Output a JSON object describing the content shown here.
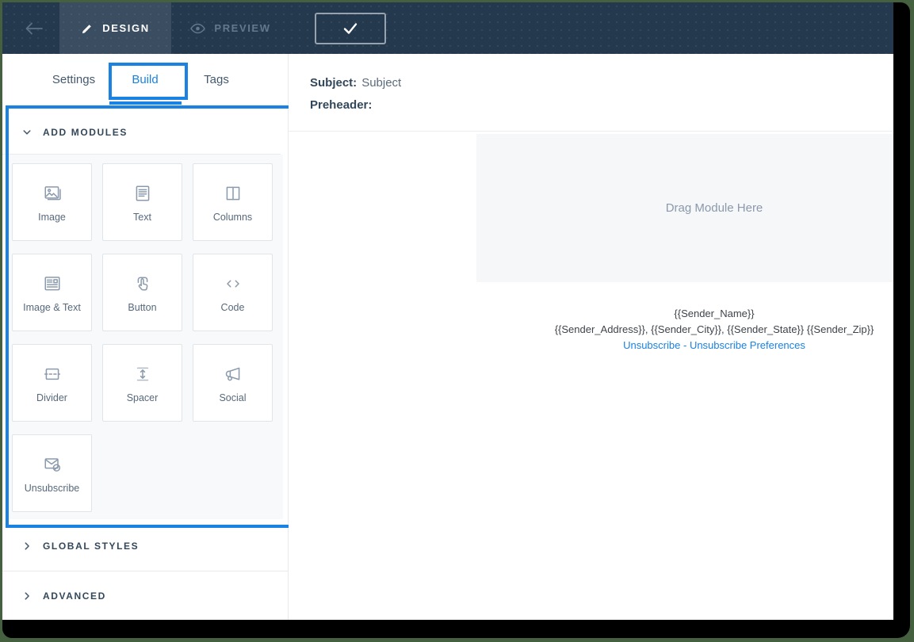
{
  "topbar": {
    "back_icon": "arrow-left-icon",
    "tabs": [
      {
        "label": "DESIGN",
        "icon": "pencil-icon",
        "active": true
      },
      {
        "label": "PREVIEW",
        "icon": "eye-icon",
        "active": false
      }
    ],
    "confirm_icon": "check-icon"
  },
  "sidebar": {
    "tabs": [
      {
        "label": "Settings",
        "active": false
      },
      {
        "label": "Build",
        "active": true
      },
      {
        "label": "Tags",
        "active": false
      }
    ],
    "sections": [
      {
        "label": "ADD MODULES",
        "expanded": true,
        "icon": "chevron-down-icon"
      },
      {
        "label": "GLOBAL STYLES",
        "expanded": false,
        "icon": "chevron-right-icon"
      },
      {
        "label": "ADVANCED",
        "expanded": false,
        "icon": "chevron-right-icon"
      }
    ],
    "modules": [
      {
        "label": "Image",
        "icon": "image-icon"
      },
      {
        "label": "Text",
        "icon": "text-icon"
      },
      {
        "label": "Columns",
        "icon": "columns-icon"
      },
      {
        "label": "Image & Text",
        "icon": "image-text-icon"
      },
      {
        "label": "Button",
        "icon": "button-icon"
      },
      {
        "label": "Code",
        "icon": "code-icon"
      },
      {
        "label": "Divider",
        "icon": "divider-icon"
      },
      {
        "label": "Spacer",
        "icon": "spacer-icon"
      },
      {
        "label": "Social",
        "icon": "social-icon"
      },
      {
        "label": "Unsubscribe",
        "icon": "unsubscribe-icon"
      }
    ]
  },
  "main": {
    "subject_label": "Subject:",
    "subject_value": "Subject",
    "preheader_label": "Preheader:",
    "preheader_value": "",
    "drag_placeholder": "Drag Module Here",
    "footer": {
      "sender_name": "{{Sender_Name}}",
      "sender_address_line": "{{Sender_Address}}, {{Sender_City}}, {{Sender_State}} {{Sender_Zip}}",
      "links": [
        {
          "label": "Unsubscribe"
        },
        {
          "label": "Unsubscribe Preferences"
        }
      ],
      "link_separator": "-"
    }
  },
  "colors": {
    "topbar_bg": "#25394e",
    "active_topbar_tab_bg": "#3b4e61",
    "accent_blue": "#1a82e2",
    "annotation_blue": "#1a82e2",
    "link_blue": "#1a82e2",
    "heading_navy": "#33475b",
    "muted_icon_gray": "#8b9aac",
    "drag_area_bg": "#f6f7f9",
    "frame_black": "#000000",
    "frame_green": "#45603f"
  }
}
